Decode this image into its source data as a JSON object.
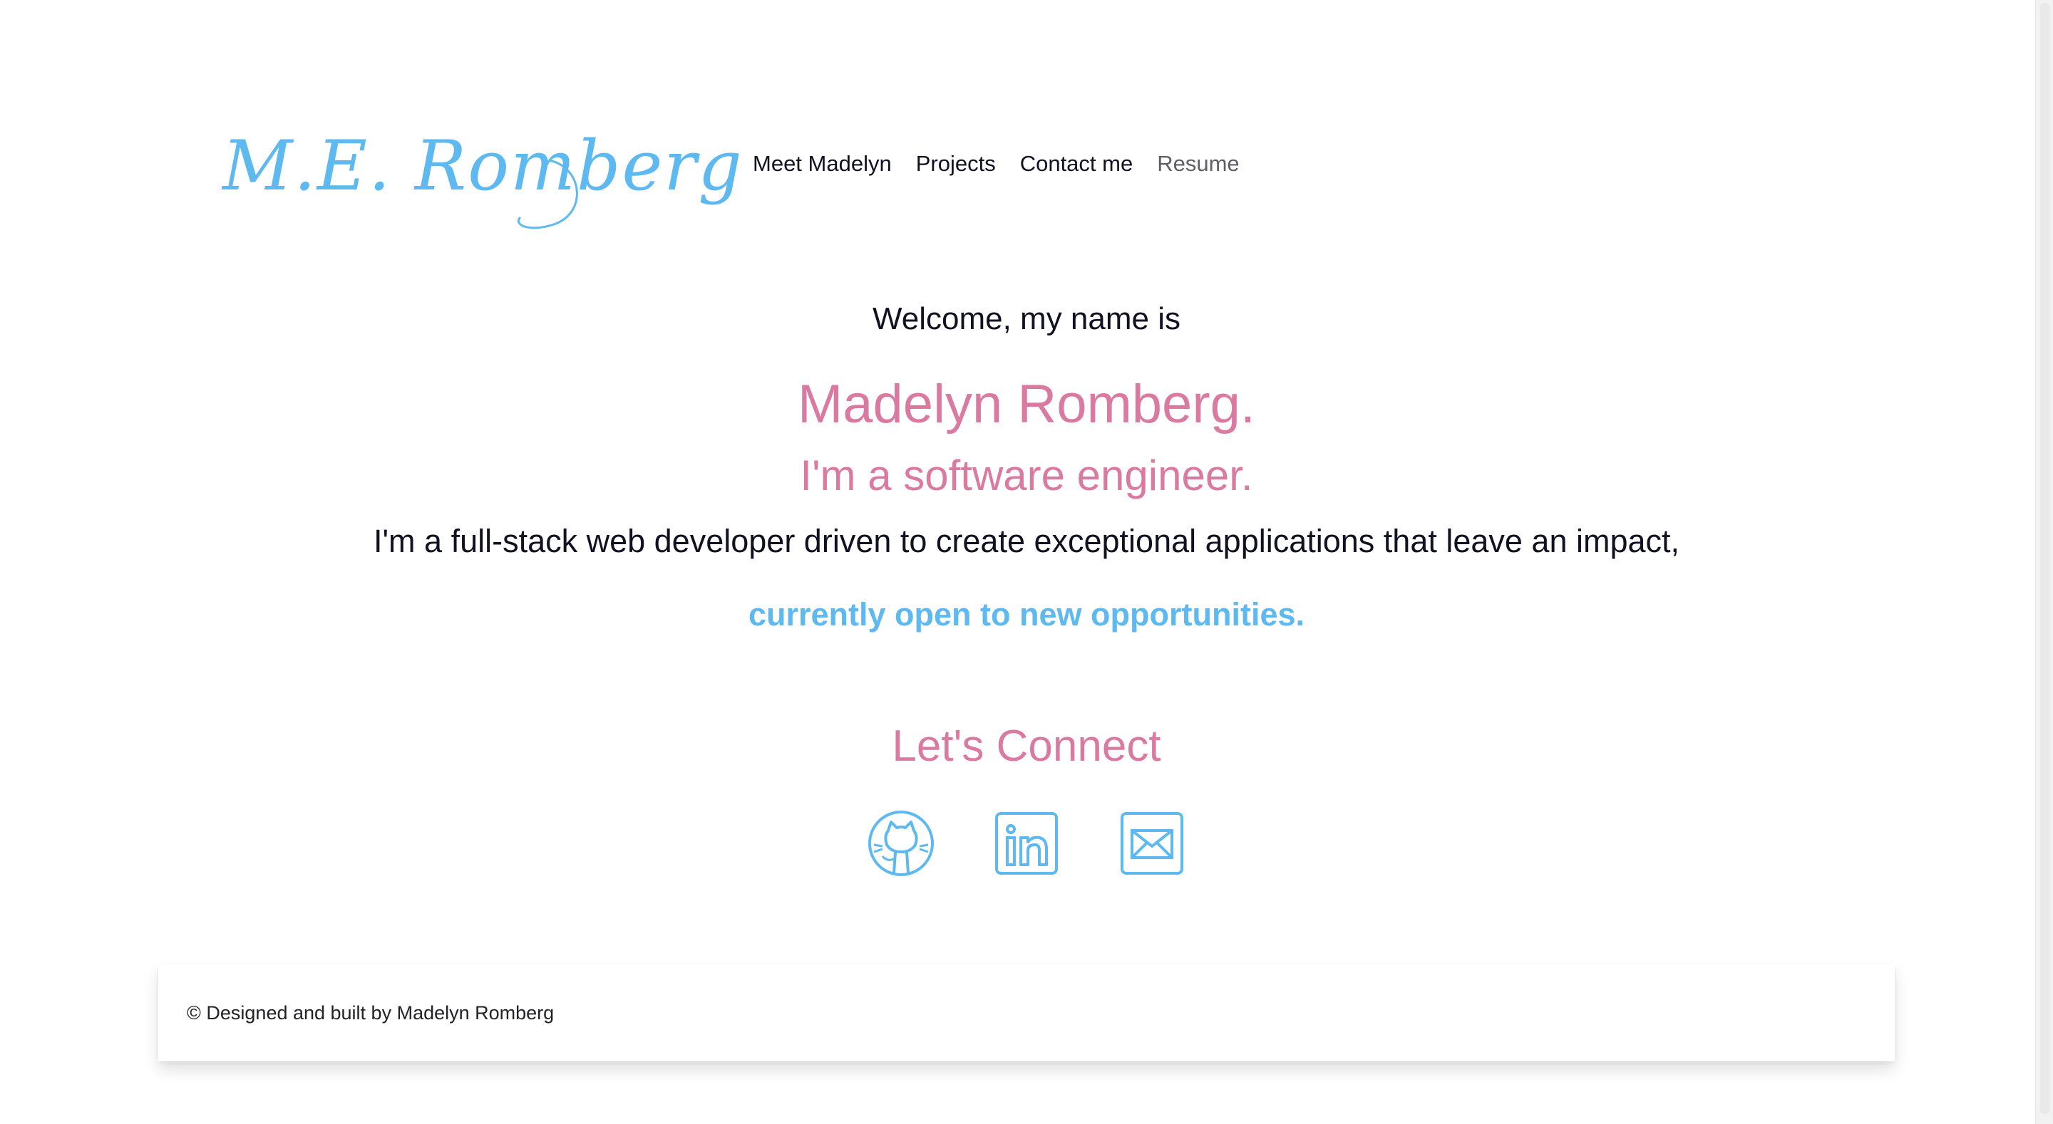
{
  "header": {
    "logo_text": "M.E. Romberg",
    "nav": [
      {
        "label": "Meet Madelyn"
      },
      {
        "label": "Projects"
      },
      {
        "label": "Contact me"
      },
      {
        "label": "Resume"
      }
    ]
  },
  "hero": {
    "welcome": "Welcome, my name is",
    "name": "Madelyn Romberg.",
    "role": "I'm a software engineer.",
    "tagline": "I'm a full-stack web developer driven to create exceptional applications that leave an impact,",
    "open": "currently open to new opportunities."
  },
  "connect": {
    "heading": "Let's Connect",
    "icons": [
      "github-icon",
      "linkedin-icon",
      "email-icon"
    ]
  },
  "footer": {
    "text": "© Designed and built by Madelyn Romberg"
  },
  "colors": {
    "accent_blue": "#5db9ef",
    "accent_pink": "#db7aa1",
    "text": "#111122"
  }
}
